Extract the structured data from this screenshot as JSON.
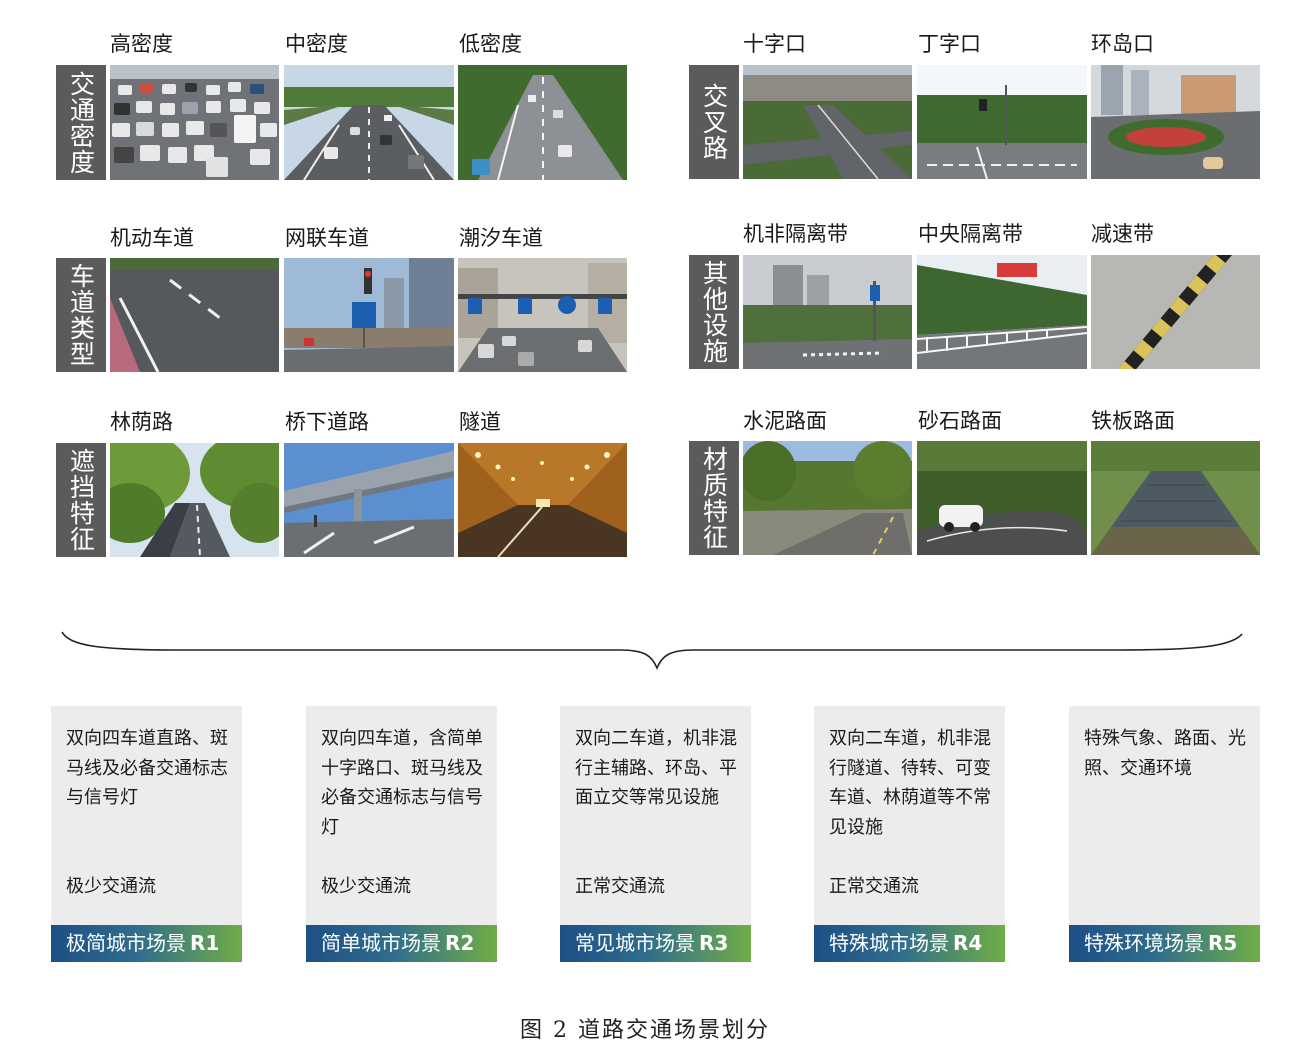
{
  "groups": {
    "density": {
      "label": "交通密度",
      "items": [
        "高密度",
        "中密度",
        "低密度"
      ]
    },
    "intersection": {
      "label": "交叉路",
      "items": [
        "十字口",
        "丁字口",
        "环岛口"
      ]
    },
    "lane": {
      "label": "车道类型",
      "items": [
        "机动车道",
        "网联车道",
        "潮汐车道"
      ]
    },
    "other": {
      "label": "其他设施",
      "items": [
        "机非隔离带",
        "中央隔离带",
        "减速带"
      ]
    },
    "occlusion": {
      "label": "遮挡特征",
      "items": [
        "林荫路",
        "桥下道路",
        "隧道"
      ]
    },
    "material": {
      "label": "材质特征",
      "items": [
        "水泥路面",
        "砂石路面",
        "铁板路面"
      ]
    }
  },
  "scenarios": [
    {
      "desc": "双向四车道直路、斑马线及必备交通标志与信号灯",
      "flow": "极少交通流",
      "name": "极简城市场景",
      "code": "R1"
    },
    {
      "desc": "双向四车道，含简单十字路口、斑马线及必备交通标志与信号灯",
      "flow": "极少交通流",
      "name": "简单城市场景",
      "code": "R2"
    },
    {
      "desc": "双向二车道，机非混行主辅路、环岛、平面立交等常见设施",
      "flow": "正常交通流",
      "name": "常见城市场景",
      "code": "R3"
    },
    {
      "desc": "双向二车道，机非混行隧道、待转、可变车道、林荫道等不常见设施",
      "flow": "正常交通流",
      "name": "特殊城市场景",
      "code": "R4"
    },
    {
      "desc": "特殊气象、路面、光照、交通环境",
      "flow": "",
      "name": "特殊环境场景",
      "code": "R5"
    }
  ],
  "figure_caption": "图 2  道路交通场景划分"
}
